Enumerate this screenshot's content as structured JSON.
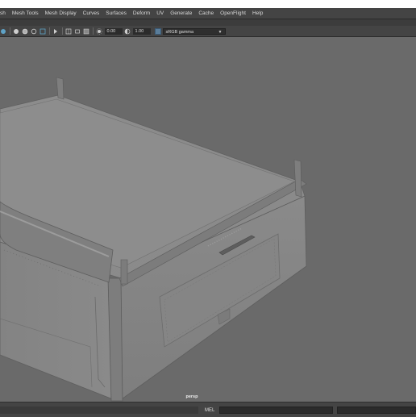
{
  "menubar": {
    "items": [
      "sh",
      "Mesh Tools",
      "Mesh Display",
      "Curves",
      "Surfaces",
      "Deform",
      "UV",
      "Generate",
      "Cache",
      "OpenFlight",
      "Help"
    ]
  },
  "toolbar": {
    "exposure_value": "0.00",
    "gamma_value": "1.00",
    "color_space": "sRGB gamma",
    "icons": [
      "camera-icon",
      "shaded-icon",
      "wireframe-icon",
      "smooth-icon",
      "xray-icon",
      "isolate-icon",
      "grid-icon",
      "resolution-gate-icon",
      "film-gate-icon",
      "exposure-icon",
      "gamma-icon",
      "color-management-icon"
    ]
  },
  "viewport": {
    "camera_label": "persp",
    "background_color": "#6a6a6a",
    "model_color": "#8f8f8f"
  },
  "statusbar": {
    "command_language": "MEL"
  }
}
